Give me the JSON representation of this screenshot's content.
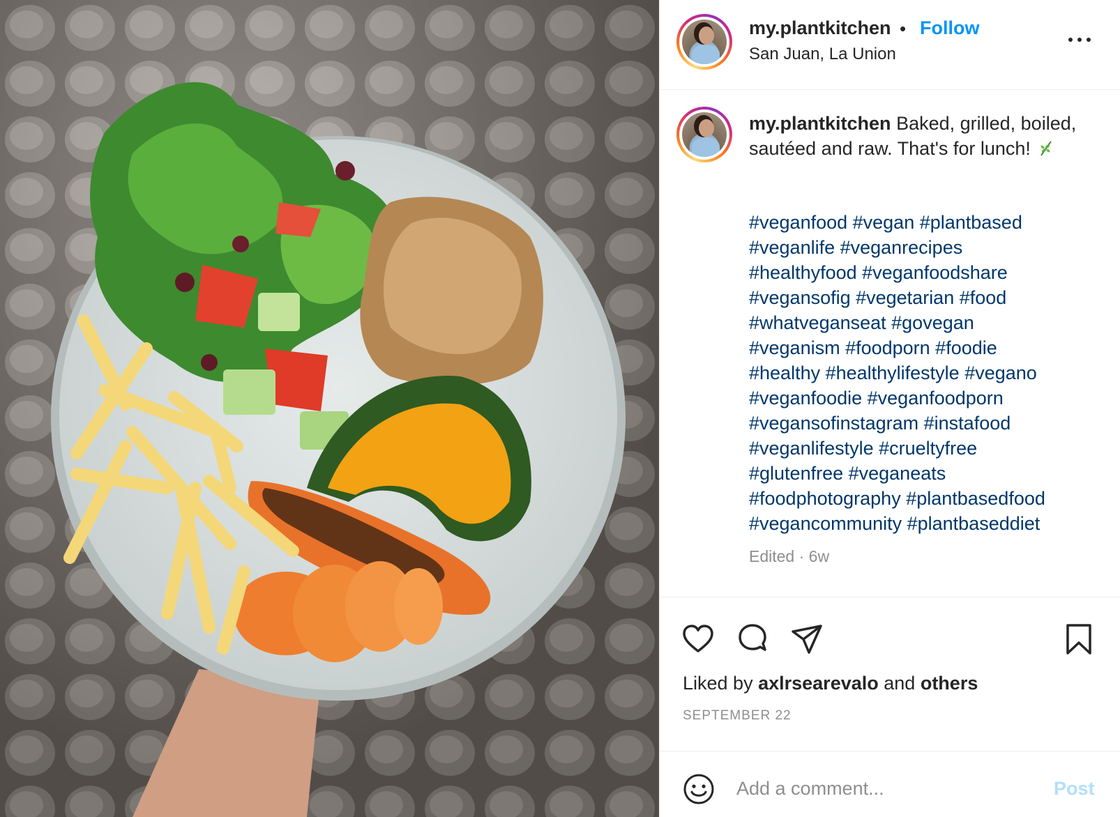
{
  "post": {
    "username": "my.plantkitchen",
    "dot": "•",
    "follow_label": "Follow",
    "location": "San Juan, La Union",
    "more_icon": "more-dots-icon"
  },
  "caption": {
    "username": "my.plantkitchen",
    "text": "Baked, grilled, boiled, sautéed and raw. That's for lunch!",
    "emoji": "herb-leaf-icon",
    "hashtag_lines": [
      "#veganfood #vegan #plantbased",
      "#veganlife #veganrecipes",
      "#healthyfood #veganfoodshare",
      "#vegansofig #vegetarian #food",
      "#whatveganseat #govegan",
      "#veganism #foodporn #foodie",
      "#healthy #healthylifestyle #vegano",
      "#veganfoodie #veganfoodporn",
      "#vegansofinstagram #instafood",
      "#veganlifestyle #crueltyfree",
      "#glutenfree #veganeats",
      "#foodphotography #plantbasedfood",
      "#vegancommunity #plantbaseddiet"
    ],
    "edited_label": "Edited · 6w"
  },
  "actions": {
    "icons": [
      "heart-icon",
      "comment-icon",
      "share-icon",
      "bookmark-icon"
    ],
    "liked_by_prefix": "Liked by",
    "liked_by_user": "axlrsearevalo",
    "liked_by_and": "and",
    "liked_by_others": "others",
    "date": "SEPTEMBER 22"
  },
  "comment": {
    "placeholder": "Add a comment...",
    "post_label": "Post",
    "emoji_icon": "smiley-icon"
  },
  "colors": {
    "link_blue": "#0095f6",
    "hashtag_blue": "#00376b",
    "muted_gray": "#8e8e8e",
    "post_disabled": "#b2dffc",
    "text": "#262626"
  },
  "image": {
    "subject": "vegan-lunch-plate"
  }
}
